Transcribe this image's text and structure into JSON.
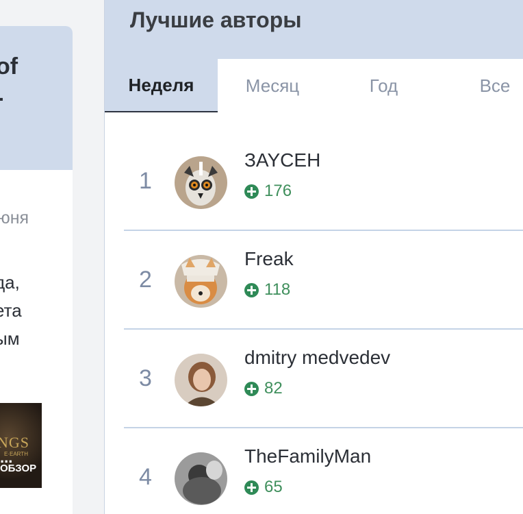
{
  "left": {
    "title": "of\n-",
    "date": "юня",
    "text": "да,\nета\nым",
    "image_logo": "NGS",
    "image_subtitle": "E·EARTH",
    "image_dots": "...",
    "image_tag": "ОБЗОР"
  },
  "panel": {
    "title": "Лучшие авторы",
    "tabs": [
      {
        "label": "Неделя",
        "active": true
      },
      {
        "label": "Месяц",
        "active": false
      },
      {
        "label": "Год",
        "active": false
      },
      {
        "label": "Все",
        "active": false
      }
    ],
    "authors": [
      {
        "rank": "1",
        "name": "ЗAYCEH",
        "score": "176",
        "avatar": "lemur-avatar"
      },
      {
        "rank": "2",
        "name": "Freak",
        "score": "118",
        "avatar": "shiba-avatar"
      },
      {
        "rank": "3",
        "name": "dmitry medvedev",
        "score": "82",
        "avatar": "portrait-avatar"
      },
      {
        "rank": "4",
        "name": "TheFamilyMan",
        "score": "65",
        "avatar": "bw-photo-avatar"
      }
    ]
  },
  "colors": {
    "header_bg": "#cfdaeb",
    "score_green": "#2f8a57",
    "rank_gray": "#7d8ba4"
  }
}
